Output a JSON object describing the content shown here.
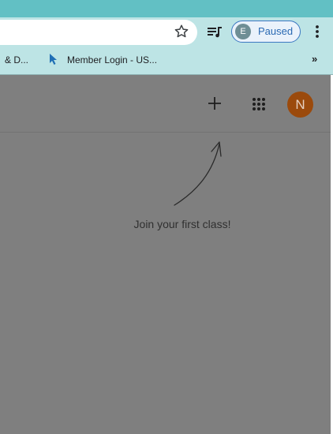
{
  "browser": {
    "profile_initial": "E",
    "profile_label": "Paused",
    "bookmarks": [
      {
        "label": "& D..."
      },
      {
        "label": "Member Login - US..."
      }
    ],
    "overflow_label": "»"
  },
  "header": {
    "avatar_initial": "N",
    "icons": [
      "plus-icon",
      "apps-grid-icon"
    ]
  },
  "main": {
    "empty_message": "Join your first class!"
  },
  "colors": {
    "browser_strip": "#62c0c4",
    "browser_toolbar": "#bde4e5",
    "page_overlay": "#7f7f7f",
    "avatar": "#9b4a0c",
    "profile_chip_border": "#3b78c2"
  }
}
